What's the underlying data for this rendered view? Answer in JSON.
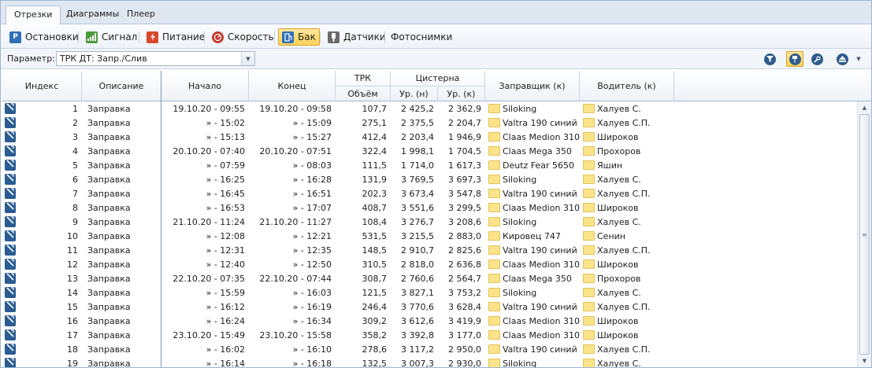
{
  "tabs": [
    {
      "label": "Отрезки",
      "active": true
    },
    {
      "label": "Диаграммы",
      "active": false
    },
    {
      "label": "Плеер",
      "active": false
    }
  ],
  "toolbar": {
    "items": [
      {
        "label": "Остановки",
        "icon": "parking-icon",
        "color": "#2f6fb8",
        "pressed": false
      },
      {
        "label": "Сигнал",
        "icon": "signal-icon",
        "color": "#4a9a3e",
        "pressed": false
      },
      {
        "label": "Питание",
        "icon": "power-icon",
        "color": "#d9472b",
        "pressed": false
      },
      {
        "label": "Скорость",
        "icon": "speedometer-icon",
        "color": "#c0392b",
        "pressed": false
      },
      {
        "label": "Бак",
        "icon": "fuel-tank-icon",
        "color": "#2f6fb8",
        "pressed": true
      },
      {
        "label": "Датчики",
        "icon": "sensor-icon",
        "color": "#6a6a6a",
        "pressed": false
      },
      {
        "label": "Фотоснимки",
        "icon": "",
        "color": "",
        "pressed": false
      }
    ]
  },
  "parameter": {
    "label": "Параметр:",
    "value": "ТРК ДТ: Запр./Слив"
  },
  "right_tools": [
    {
      "icon": "filter-icon",
      "pressed": false
    },
    {
      "icon": "pin-icon",
      "pressed": true
    },
    {
      "icon": "wrench-icon",
      "pressed": false
    },
    {
      "icon": "eject-icon",
      "pressed": false
    },
    {
      "icon": "dropdown-arrow-icon",
      "pressed": false
    }
  ],
  "columns": {
    "index": "Индекс",
    "description": "Описание",
    "start": "Начало",
    "end": "Конец",
    "trk": "ТРК",
    "volume": "Объём",
    "tank": "Цистерна",
    "level_start": "Ур. (н)",
    "level_end": "Ур. (к)",
    "fueler": "Заправщик (к)",
    "driver": "Водитель (к)"
  },
  "rows": [
    {
      "idx": "1",
      "desc": "Заправка",
      "start": "19.10.20 - 09:55",
      "end": "19.10.20 - 09:58",
      "vol": "107,7",
      "ln": "2 425,2",
      "lk": "2 362,9",
      "fueler": "Siloking",
      "driver": "Халуев С."
    },
    {
      "idx": "2",
      "desc": "Заправка",
      "start": "» - 15:02",
      "end": "» - 15:09",
      "vol": "275,1",
      "ln": "2 375,5",
      "lk": "2 204,7",
      "fueler": "Valtra 190 синий",
      "driver": "Халуев С.П."
    },
    {
      "idx": "3",
      "desc": "Заправка",
      "start": "» - 15:13",
      "end": "» - 15:27",
      "vol": "412,4",
      "ln": "2 203,4",
      "lk": "1 946,9",
      "fueler": "Claas Medion 310",
      "driver": "Широков"
    },
    {
      "idx": "4",
      "desc": "Заправка",
      "start": "20.10.20 - 07:40",
      "end": "20.10.20 - 07:51",
      "vol": "322,4",
      "ln": "1 998,1",
      "lk": "1 704,5",
      "fueler": "Claas Mega 350",
      "driver": "Прохоров"
    },
    {
      "idx": "5",
      "desc": "Заправка",
      "start": "» - 07:59",
      "end": "» - 08:03",
      "vol": "111,5",
      "ln": "1 714,0",
      "lk": "1 617,3",
      "fueler": "Deutz Fear 5650",
      "driver": "Яшин"
    },
    {
      "idx": "6",
      "desc": "Заправка",
      "start": "» - 16:25",
      "end": "» - 16:28",
      "vol": "131,9",
      "ln": "3 769,5",
      "lk": "3 697,3",
      "fueler": "Siloking",
      "driver": "Халуев С."
    },
    {
      "idx": "7",
      "desc": "Заправка",
      "start": "» - 16:45",
      "end": "» - 16:51",
      "vol": "202,3",
      "ln": "3 673,4",
      "lk": "3 547,8",
      "fueler": "Valtra 190 синий",
      "driver": "Халуев С.П."
    },
    {
      "idx": "8",
      "desc": "Заправка",
      "start": "» - 16:53",
      "end": "» - 17:07",
      "vol": "408,7",
      "ln": "3 551,6",
      "lk": "3 299,5",
      "fueler": "Claas Medion 310",
      "driver": "Широков"
    },
    {
      "idx": "9",
      "desc": "Заправка",
      "start": "21.10.20 - 11:24",
      "end": "21.10.20 - 11:27",
      "vol": "108,4",
      "ln": "3 276,7",
      "lk": "3 208,6",
      "fueler": "Siloking",
      "driver": "Халуев С."
    },
    {
      "idx": "10",
      "desc": "Заправка",
      "start": "» - 12:08",
      "end": "» - 12:21",
      "vol": "531,5",
      "ln": "3 215,5",
      "lk": "2 883,0",
      "fueler": "Кировец 747",
      "driver": "Сенин"
    },
    {
      "idx": "11",
      "desc": "Заправка",
      "start": "» - 12:31",
      "end": "» - 12:35",
      "vol": "148,5",
      "ln": "2 910,7",
      "lk": "2 825,6",
      "fueler": "Valtra 190 синий",
      "driver": "Халуев С.П."
    },
    {
      "idx": "12",
      "desc": "Заправка",
      "start": "» - 12:40",
      "end": "» - 12:50",
      "vol": "310,5",
      "ln": "2 818,0",
      "lk": "2 636,8",
      "fueler": "Claas Medion 310",
      "driver": "Широков"
    },
    {
      "idx": "13",
      "desc": "Заправка",
      "start": "22.10.20 - 07:35",
      "end": "22.10.20 - 07:44",
      "vol": "308,7",
      "ln": "2 760,6",
      "lk": "2 564,7",
      "fueler": "Claas Mega 350",
      "driver": "Прохоров"
    },
    {
      "idx": "14",
      "desc": "Заправка",
      "start": "» - 15:59",
      "end": "» - 16:03",
      "vol": "121,5",
      "ln": "3 827,1",
      "lk": "3 753,2",
      "fueler": "Siloking",
      "driver": "Халуев С."
    },
    {
      "idx": "15",
      "desc": "Заправка",
      "start": "» - 16:12",
      "end": "» - 16:19",
      "vol": "246,4",
      "ln": "3 770,6",
      "lk": "3 628,4",
      "fueler": "Valtra 190 синий",
      "driver": "Халуев С.П."
    },
    {
      "idx": "16",
      "desc": "Заправка",
      "start": "» - 16:24",
      "end": "» - 16:34",
      "vol": "309,2",
      "ln": "3 612,6",
      "lk": "3 419,9",
      "fueler": "Claas Medion 310",
      "driver": "Широков"
    },
    {
      "idx": "17",
      "desc": "Заправка",
      "start": "23.10.20 - 15:49",
      "end": "23.10.20 - 15:58",
      "vol": "358,2",
      "ln": "3 392,8",
      "lk": "3 177,0",
      "fueler": "Claas Medion 310",
      "driver": "Широков"
    },
    {
      "idx": "18",
      "desc": "Заправка",
      "start": "» - 16:02",
      "end": "» - 16:10",
      "vol": "278,6",
      "ln": "3 117,2",
      "lk": "2 950,0",
      "fueler": "Valtra 190 синий",
      "driver": "Халуев С.П."
    },
    {
      "idx": "19",
      "desc": "Заправка",
      "start": "» - 16:14",
      "end": "» - 16:18",
      "vol": "132,5",
      "ln": "3 007,3",
      "lk": "2 930,0",
      "fueler": "Siloking",
      "driver": "Халуев С."
    }
  ]
}
